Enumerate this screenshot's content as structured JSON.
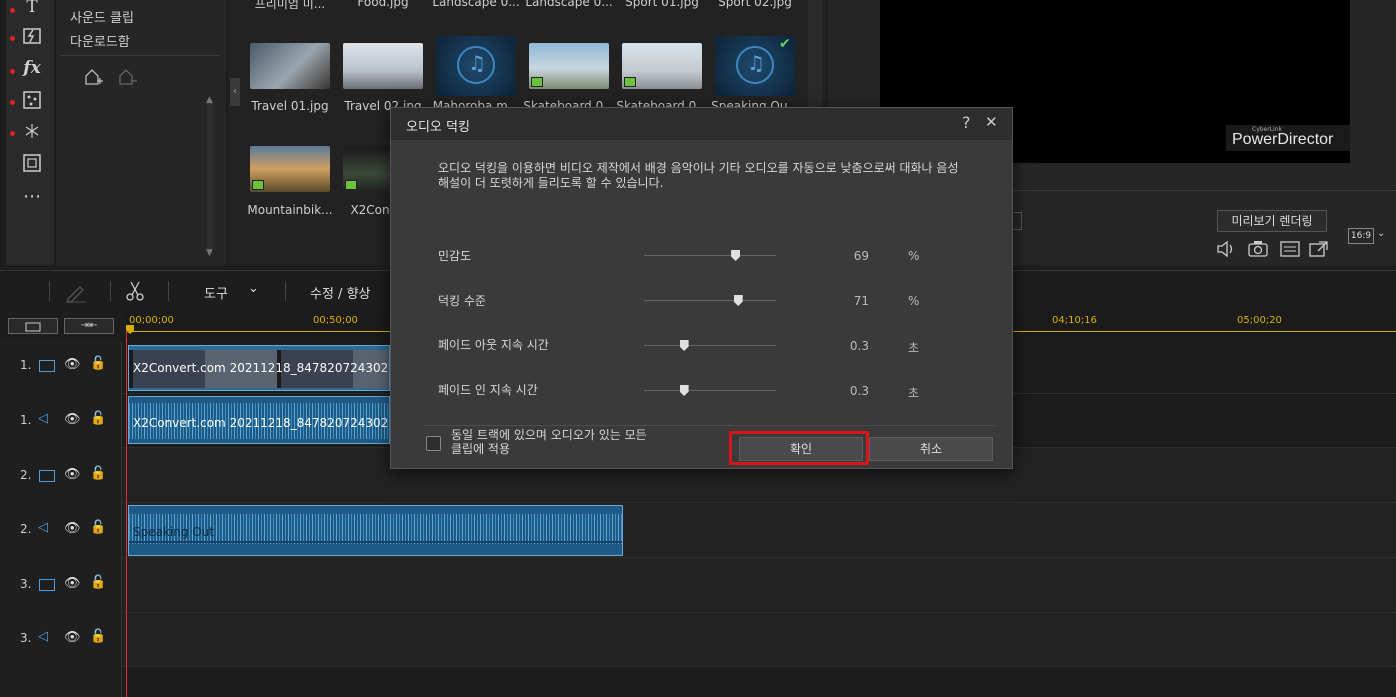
{
  "left_tools": {
    "icons": [
      "text-icon",
      "transition-icon",
      "fx-icon",
      "particle-icon",
      "sparkle-icon",
      "pip-icon",
      "more-icon"
    ],
    "more_label": "⋯"
  },
  "category_panel": {
    "items": [
      "사운드 클립",
      "다운로드함"
    ]
  },
  "media_library": {
    "top_labels": [
      "프리미엄 미...",
      "Food.jpg",
      "Landscape 0...",
      "Landscape 0...",
      "Sport 01.jpg",
      "Sport 02.jpg"
    ],
    "row1": [
      {
        "label": "Travel 01.jpg",
        "kind": "image"
      },
      {
        "label": "Travel 02.jpg",
        "kind": "image"
      },
      {
        "label": "Mahoroba.m...",
        "kind": "music"
      },
      {
        "label": "Skateboard 0...",
        "kind": "video"
      },
      {
        "label": "Skateboard 0...",
        "kind": "video"
      },
      {
        "label": "Speaking Ou...",
        "kind": "music"
      }
    ],
    "row2": [
      {
        "label": "Mountainbik...",
        "kind": "video"
      },
      {
        "label": "X2Conve...",
        "kind": "video"
      }
    ]
  },
  "preview": {
    "watermark": "PowerDirector",
    "watermark_small": "CyberLink",
    "render_button": "미리보기 렌더링",
    "aspect_ratio": "16:9"
  },
  "toolbar": {
    "tools_label": "도구",
    "edit_label": "수정 / 향상"
  },
  "timeline": {
    "ticks": [
      "00;00;00",
      "00;50;00",
      "04;10;16",
      "05;00;20"
    ],
    "tracks": [
      {
        "num": "1.",
        "type": "video"
      },
      {
        "num": "1.",
        "type": "audio"
      },
      {
        "num": "2.",
        "type": "video"
      },
      {
        "num": "2.",
        "type": "audio"
      },
      {
        "num": "3.",
        "type": "video"
      },
      {
        "num": "3.",
        "type": "audio"
      }
    ],
    "clips": {
      "video1": "X2Convert.com 20211218_847820724302169...",
      "audio1": "X2Convert.com 20211218_847820724302169...",
      "audio2": "Speaking Out"
    }
  },
  "dialog": {
    "title": "오디오 덕킹",
    "help": "?",
    "close": "✕",
    "description": "오디오 덕킹을 이용하면 비디오 제작에서 배경 음악이나 기타 오디오를 자동으로 낮춤으로써 대화나 음성 해설이 더 또렷하게 들리도록 할 수 있습니다.",
    "sliders": [
      {
        "label": "민감도",
        "value": "69",
        "unit": "%",
        "level": 0.69
      },
      {
        "label": "덕킹 수준",
        "value": "71",
        "unit": "%",
        "level": 0.71
      },
      {
        "label": "페이드 아웃 지속 시간",
        "value": "0.3",
        "unit": "초",
        "level": 0.3
      },
      {
        "label": "페이드 인 지속 시간",
        "value": "0.3",
        "unit": "초",
        "level": 0.3
      }
    ],
    "checkbox_label": "동일 트랙에 있으며 오디오가 있는 모든 클립에 적용",
    "ok": "확인",
    "cancel": "취소"
  },
  "colors": {
    "accent_red": "#d9141b",
    "playhead": "#e03030",
    "video_clip": "#2d6b96",
    "audio_clip": "#1f5a85",
    "wave": "#3d8fc6"
  }
}
